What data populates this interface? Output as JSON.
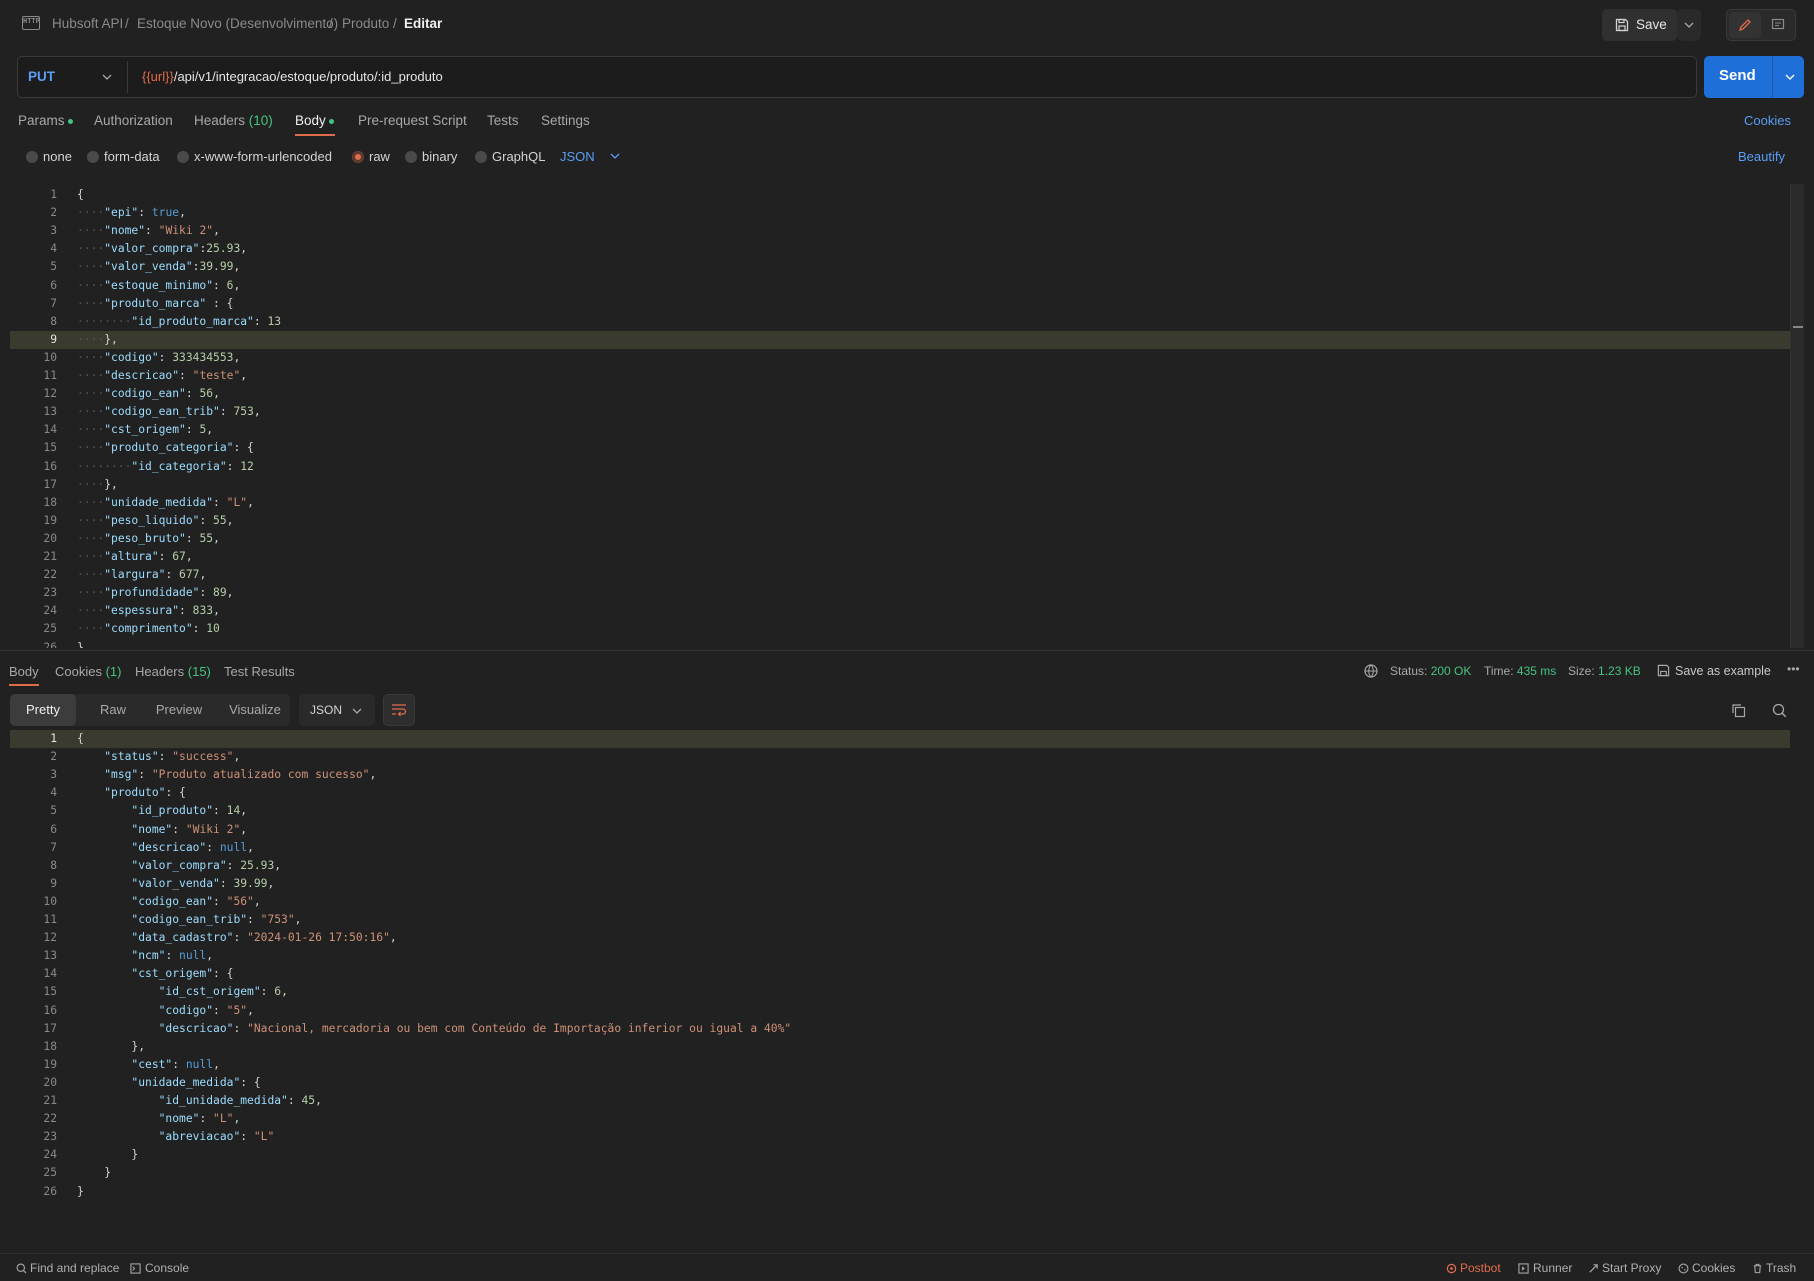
{
  "breadcrumb": {
    "icon_text": "HTTP",
    "items": [
      "Hubsoft API",
      "Estoque Novo (Desenvolvimento)",
      "Produto"
    ],
    "separators": [
      "/",
      "/",
      "/"
    ],
    "current": "Editar"
  },
  "toolbar": {
    "save_label": "Save"
  },
  "request": {
    "method": "PUT",
    "url_var": "{{url}}",
    "url_path": "/api/v1/integracao/estoque/produto/:id_produto",
    "send_label": "Send"
  },
  "req_tabs": {
    "params": "Params",
    "authorization": "Authorization",
    "headers": "Headers",
    "headers_count": "(10)",
    "body": "Body",
    "prerequest": "Pre-request Script",
    "tests": "Tests",
    "settings": "Settings",
    "cookies": "Cookies"
  },
  "body_types": {
    "none": "none",
    "form_data": "form-data",
    "urlencoded": "x-www-form-urlencoded",
    "raw": "raw",
    "binary": "binary",
    "graphql": "GraphQL",
    "format": "JSON",
    "beautify": "Beautify"
  },
  "request_body": [
    "{",
    "    \"epi\": true,",
    "    \"nome\": \"Wiki 2\",",
    "    \"valor_compra\":25.93,",
    "    \"valor_venda\":39.99,",
    "    \"estoque_minimo\": 6,",
    "    \"produto_marca\" : {",
    "        \"id_produto_marca\": 13",
    "    },",
    "    \"codigo\": 333434553,",
    "    \"descricao\": \"teste\",",
    "    \"codigo_ean\": 56,",
    "    \"codigo_ean_trib\": 753,",
    "    \"cst_origem\": 5,",
    "    \"produto_categoria\": {",
    "        \"id_categoria\": 12",
    "    },",
    "    \"unidade_medida\": \"L\",",
    "    \"peso_liquido\": 55,",
    "    \"peso_bruto\": 55,",
    "    \"altura\": 67,",
    "    \"largura\": 677,",
    "    \"profundidade\": 89,",
    "    \"espessura\": 833,",
    "    \"comprimento\": 10",
    "}"
  ],
  "response": {
    "tabs": {
      "body": "Body",
      "cookies": "Cookies",
      "cookies_count": "(1)",
      "headers": "Headers",
      "headers_count": "(15)",
      "test_results": "Test Results"
    },
    "status_label": "Status:",
    "status_value": "200 OK",
    "time_label": "Time:",
    "time_value": "435 ms",
    "size_label": "Size:",
    "size_value": "1.23 KB",
    "save_example": "Save as example",
    "more": "•••",
    "views": {
      "pretty": "Pretty",
      "raw": "Raw",
      "preview": "Preview",
      "visualize": "Visualize"
    },
    "format": "JSON",
    "body": [
      "{",
      "    \"status\": \"success\",",
      "    \"msg\": \"Produto atualizado com sucesso\",",
      "    \"produto\": {",
      "        \"id_produto\": 14,",
      "        \"nome\": \"Wiki 2\",",
      "        \"descricao\": null,",
      "        \"valor_compra\": 25.93,",
      "        \"valor_venda\": 39.99,",
      "        \"codigo_ean\": \"56\",",
      "        \"codigo_ean_trib\": \"753\",",
      "        \"data_cadastro\": \"2024-01-26 17:50:16\",",
      "        \"ncm\": null,",
      "        \"cst_origem\": {",
      "            \"id_cst_origem\": 6,",
      "            \"codigo\": \"5\",",
      "            \"descricao\": \"Nacional, mercadoria ou bem com Conteúdo de Importação inferior ou igual a 40%\"",
      "        },",
      "        \"cest\": null,",
      "        \"unidade_medida\": {",
      "            \"id_unidade_medida\": 45,",
      "            \"nome\": \"L\",",
      "            \"abreviacao\": \"L\"",
      "        }",
      "    }",
      "}"
    ]
  },
  "footer": {
    "find_replace": "Find and replace",
    "console": "Console",
    "postbot": "Postbot",
    "runner": "Runner",
    "start_proxy": "Start Proxy",
    "cookies": "Cookies",
    "trash": "Trash"
  }
}
